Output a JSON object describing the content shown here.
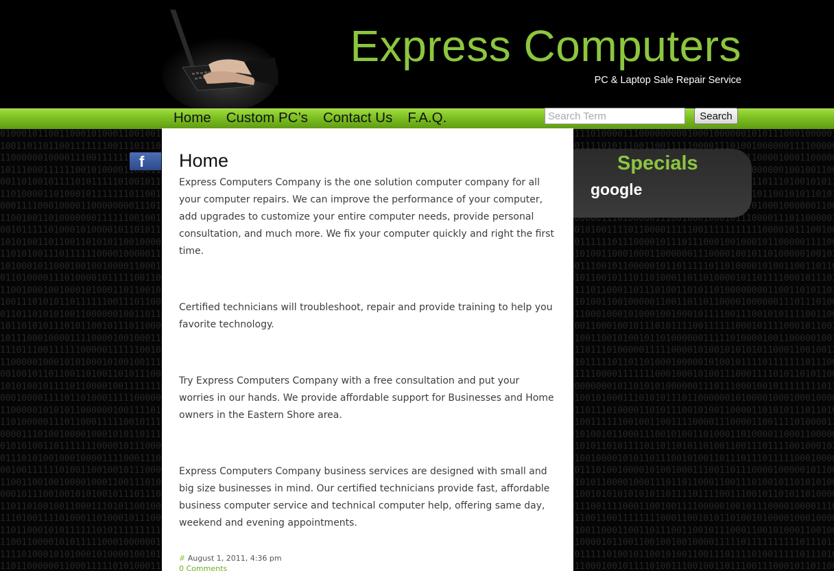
{
  "header": {
    "title": "Express Computers",
    "tagline": "PC & Laptop Sale Repair Service"
  },
  "nav": {
    "items": [
      {
        "label": "Home"
      },
      {
        "label": "Custom PC’s"
      },
      {
        "label": "Contact Us"
      },
      {
        "label": "F.A.Q."
      }
    ]
  },
  "search": {
    "placeholder": "Search Term",
    "button_label": "Search"
  },
  "social": {
    "facebook_letter": "f",
    "icon": "facebook-icon"
  },
  "main": {
    "title": "Home",
    "paragraphs": [
      "Express Computers Company is the one solution computer company for all your computer repairs. We can improve the performance of your computer, add upgrades to customize your entire computer needs, provide personal consultation, and much more. We fix your computer quickly and right the first time.",
      "Certified technicians will troubleshoot, repair and provide training to help you favorite technology.",
      "Try Express Computers Company with a free consultation and put your worries in our hands. We provide affordable support for Businesses and Home owners in the Eastern Shore area.",
      "Express Computers Company business services are designed with small and big size businesses in mind. Our certified technicians provide fast, affordable business computer service and technical computer help, offering same day, weekend and evening appointments."
    ],
    "meta_hash": "#",
    "meta_date": "August 1, 2011, 4:36 pm",
    "comments": "0 Comments"
  },
  "sidebar": {
    "specials_title": "Specials",
    "specials_item": "google"
  },
  "colors": {
    "accent": "#8cc63f",
    "nav_green": "#7bbf22",
    "background": "#000000"
  }
}
